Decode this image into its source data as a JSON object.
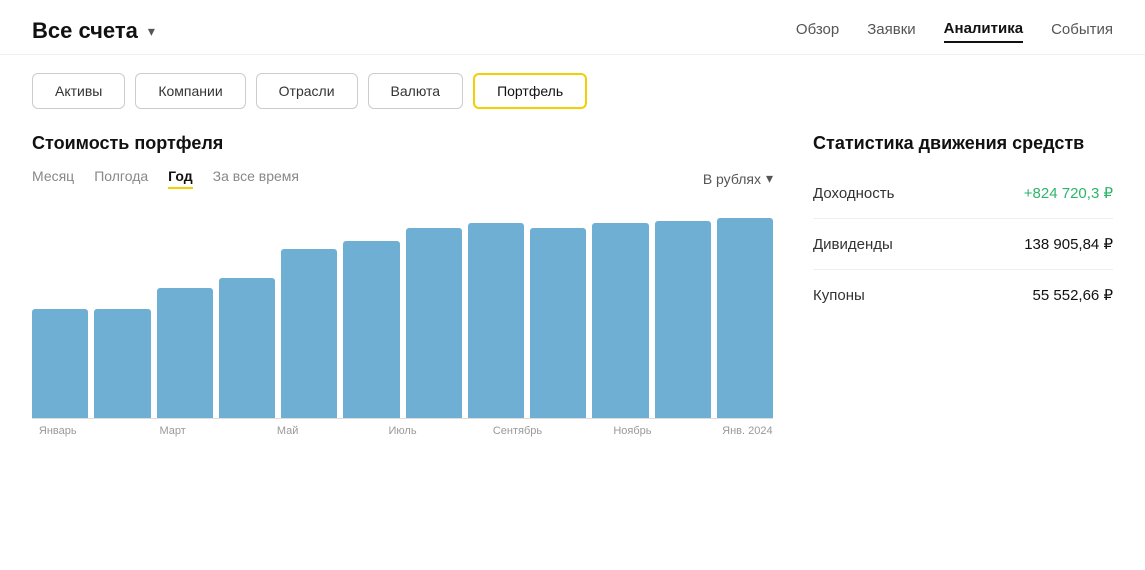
{
  "header": {
    "title": "Все счета",
    "chevron": "▾",
    "nav": [
      {
        "label": "Обзор",
        "active": false
      },
      {
        "label": "Заявки",
        "active": false
      },
      {
        "label": "Аналитика",
        "active": true
      },
      {
        "label": "События",
        "active": false
      }
    ]
  },
  "tabs": [
    {
      "label": "Активы",
      "active": false
    },
    {
      "label": "Компании",
      "active": false
    },
    {
      "label": "Отрасли",
      "active": false
    },
    {
      "label": "Валюта",
      "active": false
    },
    {
      "label": "Портфель",
      "active": true
    }
  ],
  "chart_section": {
    "title": "Стоимость портфеля",
    "periods": [
      {
        "label": "Месяц",
        "active": false
      },
      {
        "label": "Полгода",
        "active": false
      },
      {
        "label": "Год",
        "active": true
      },
      {
        "label": "За все время",
        "active": false
      }
    ],
    "currency_label": "В рублях",
    "x_labels": [
      "Январь",
      "",
      "Март",
      "",
      "Май",
      "",
      "Июль",
      "",
      "Сентябрь",
      "",
      "Ноябрь",
      "",
      "Янв. 2024"
    ],
    "bars": [
      42,
      42,
      50,
      54,
      65,
      68,
      73,
      75,
      73,
      75,
      76,
      77
    ]
  },
  "stats_section": {
    "title": "Статистика движения средств",
    "items": [
      {
        "label": "Доходность",
        "value": "+824 720,3 ₽",
        "positive": true
      },
      {
        "label": "Дивиденды",
        "value": "138 905,84 ₽",
        "positive": false
      },
      {
        "label": "Купоны",
        "value": "55 552,66 ₽",
        "positive": false
      }
    ]
  }
}
